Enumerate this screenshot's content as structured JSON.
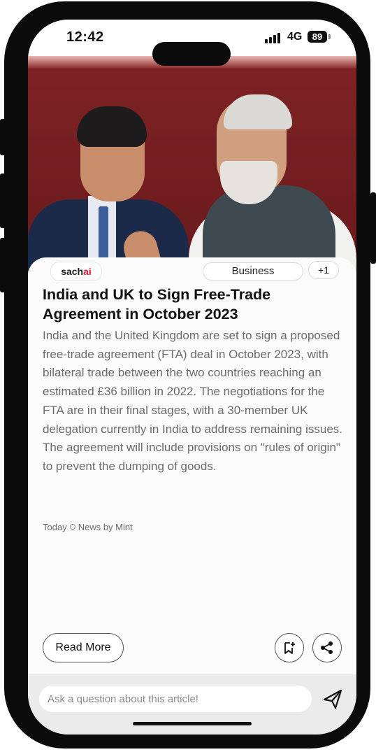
{
  "status_bar": {
    "time": "12:42",
    "network": "4G",
    "battery": "89"
  },
  "article": {
    "brand": {
      "prefix": "sach",
      "suffix": "ai"
    },
    "category": "Business",
    "extra_tags": "+1",
    "headline": "India and UK to Sign Free-Trade Agreement in October 2023",
    "body": "India and the United Kingdom are set to sign a proposed free-trade agreement (FTA) deal in October 2023, with bilateral trade between the two countries reaching an estimated £36 billion in 2022. The negotiations for the FTA are in their final stages, with a 30-member UK delegation currently in India to address remaining issues. The agreement will include provisions on \"rules of origin\" to prevent the dumping of goods.",
    "date": "Today",
    "source": "News by Mint"
  },
  "actions": {
    "read_more_label": "Read More",
    "bookmark_icon": "bookmark-add-icon",
    "share_icon": "share-icon"
  },
  "ask": {
    "placeholder": "Ask a question about this article!",
    "send_icon": "send-icon"
  },
  "colors": {
    "brand_accent": "#e0193a",
    "hero_bg": "#7d2224"
  }
}
